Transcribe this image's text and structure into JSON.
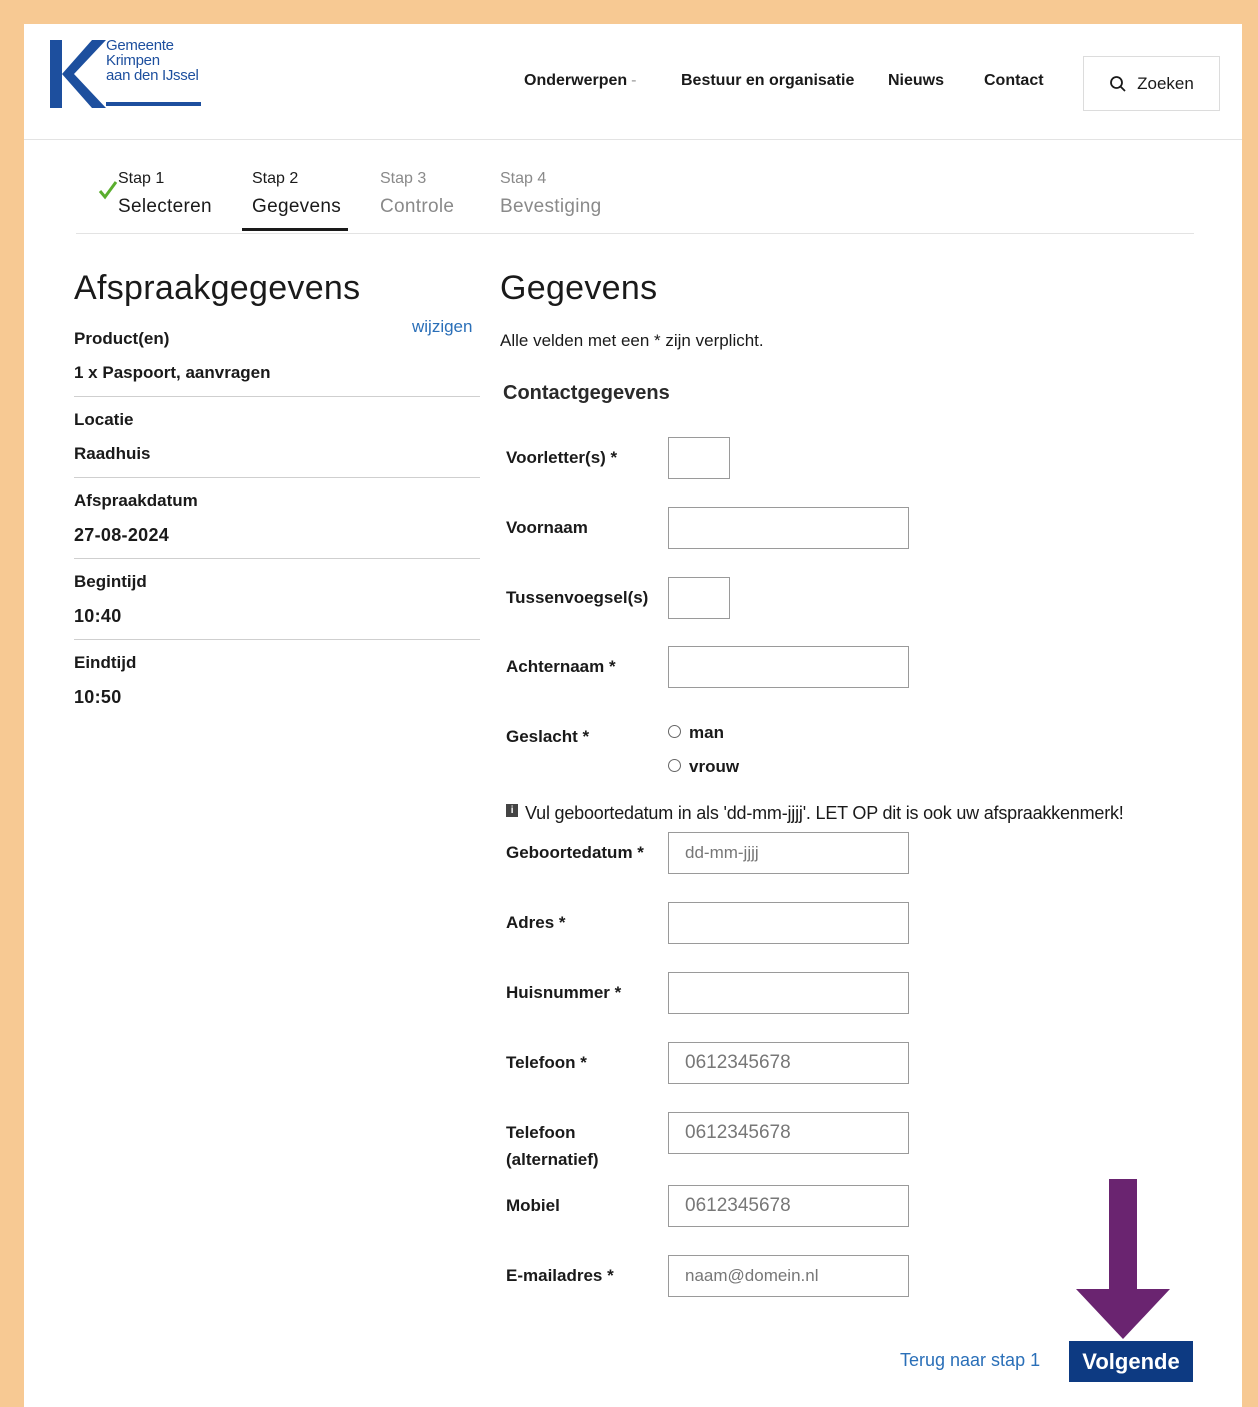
{
  "logo": {
    "line1": "Gemeente",
    "line2": "Krimpen",
    "line3": "aan den IJssel"
  },
  "nav": {
    "items": [
      {
        "label": "Onderwerpen"
      },
      {
        "label": "Bestuur en organisatie"
      },
      {
        "label": "Nieuws"
      },
      {
        "label": "Contact"
      }
    ],
    "search_label": "Zoeken"
  },
  "steps": [
    {
      "num": "Stap 1",
      "label": "Selecteren",
      "state": "done"
    },
    {
      "num": "Stap 2",
      "label": "Gegevens",
      "state": "active"
    },
    {
      "num": "Stap 3",
      "label": "Controle",
      "state": "todo"
    },
    {
      "num": "Stap 4",
      "label": "Bevestiging",
      "state": "todo"
    }
  ],
  "summary": {
    "title": "Afspraakgegevens",
    "edit_link": "wijzigen",
    "products_label": "Product(en)",
    "products_value": "1 x Paspoort, aanvragen",
    "location_label": "Locatie",
    "location_value": "Raadhuis",
    "date_label": "Afspraakdatum",
    "date_value": "27-08-2024",
    "start_label": "Begintijd",
    "start_value": "10:40",
    "end_label": "Eindtijd",
    "end_value": "10:50"
  },
  "form": {
    "title": "Gegevens",
    "required_note": "Alle velden met een * zijn verplicht.",
    "section_title": "Contactgegevens",
    "initials_label": "Voorletter(s) *",
    "firstname_label": "Voornaam",
    "infix_label": "Tussenvoegsel(s)",
    "lastname_label": "Achternaam *",
    "gender_label": "Geslacht *",
    "gender_options": [
      "man",
      "vrouw"
    ],
    "info_note": "Vul geboortedatum in als 'dd-mm-jjjj'. LET OP dit is ook uw afspraakkenmerk!",
    "birthdate_label": "Geboortedatum *",
    "birthdate_placeholder": "dd-mm-jjjj",
    "address_label": "Adres *",
    "housenumber_label": "Huisnummer *",
    "phone_label": "Telefoon *",
    "phone_placeholder": "0612345678",
    "phone_alt_label_1": "Telefoon",
    "phone_alt_label_2": "(alternatief)",
    "phone_alt_placeholder": "0612345678",
    "mobile_label": "Mobiel",
    "mobile_placeholder": "0612345678",
    "email_label": "E-mailadres *",
    "email_placeholder": "naam@domein.nl"
  },
  "footer": {
    "back_link": "Terug naar stap 1",
    "next_button": "Volgende"
  },
  "colors": {
    "frame_bg": "#f7c993",
    "brand_blue": "#1d4f9e",
    "button_blue": "#0d3a82",
    "link_blue": "#2a6fb8",
    "arrow_purple": "#6a2470",
    "check_green": "#5aae2e"
  }
}
